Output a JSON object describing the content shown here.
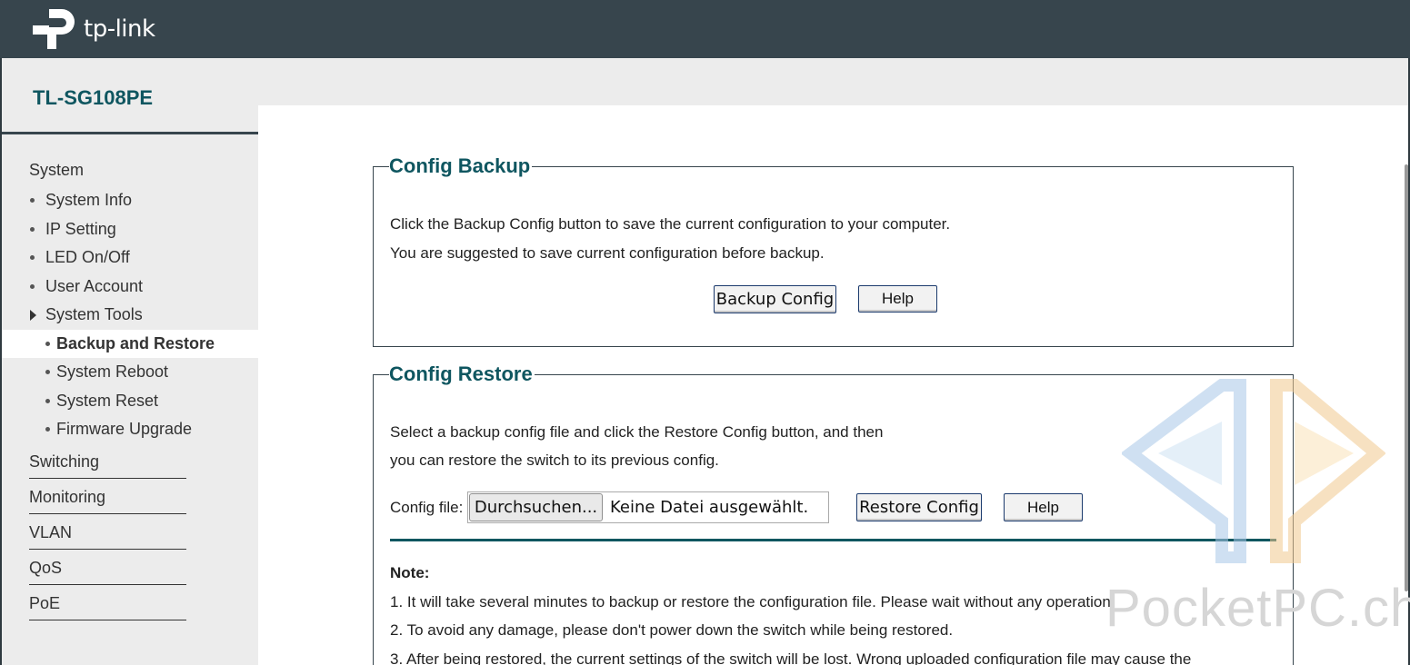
{
  "header": {
    "brand": "tp-link",
    "model": "TL-SG108PE"
  },
  "sidebar": {
    "items": [
      {
        "label": "System",
        "level": 0
      },
      {
        "label": "System Info",
        "level": 1
      },
      {
        "label": "IP Setting",
        "level": 1
      },
      {
        "label": "LED On/Off",
        "level": 1
      },
      {
        "label": "User Account",
        "level": 1
      },
      {
        "label": "System Tools",
        "level": 1,
        "expanded": true
      },
      {
        "label": "Backup and Restore",
        "level": 2,
        "active": true
      },
      {
        "label": "System Reboot",
        "level": 2
      },
      {
        "label": "System Reset",
        "level": 2
      },
      {
        "label": "Firmware Upgrade",
        "level": 2
      },
      {
        "label": "Switching",
        "level": 0
      },
      {
        "label": "Monitoring",
        "level": 0
      },
      {
        "label": "VLAN",
        "level": 0
      },
      {
        "label": "QoS",
        "level": 0
      },
      {
        "label": "PoE",
        "level": 0
      }
    ]
  },
  "backup": {
    "title": "Config Backup",
    "line1": "Click the Backup Config button to save the current configuration to your computer.",
    "line2": "You are suggested to save current configuration before backup.",
    "backup_button": "Backup Config",
    "help_button": "Help"
  },
  "restore": {
    "title": "Config Restore",
    "line1": "Select a backup config file and click the Restore Config button, and then",
    "line2": "you can restore the switch to its previous config.",
    "file_label": "Config file:",
    "browse_button": "Durchsuchen...",
    "file_status": "Keine Datei ausgewählt.",
    "restore_button": "Restore Config",
    "help_button": "Help"
  },
  "note": {
    "title": "Note:",
    "items": [
      "1. It will take several minutes to backup or restore the configuration file. Please wait without any operation.",
      "2. To avoid any damage, please don't power down the switch while being restored.",
      "3. After being restored, the current settings of the switch will be lost. Wrong uploaded configuration file may cause the"
    ]
  },
  "watermark": {
    "text": "PocketPC.ch"
  },
  "colors": {
    "topbar": "#37454d",
    "accent": "#0f5660",
    "sidebar_bg": "#ececec"
  }
}
